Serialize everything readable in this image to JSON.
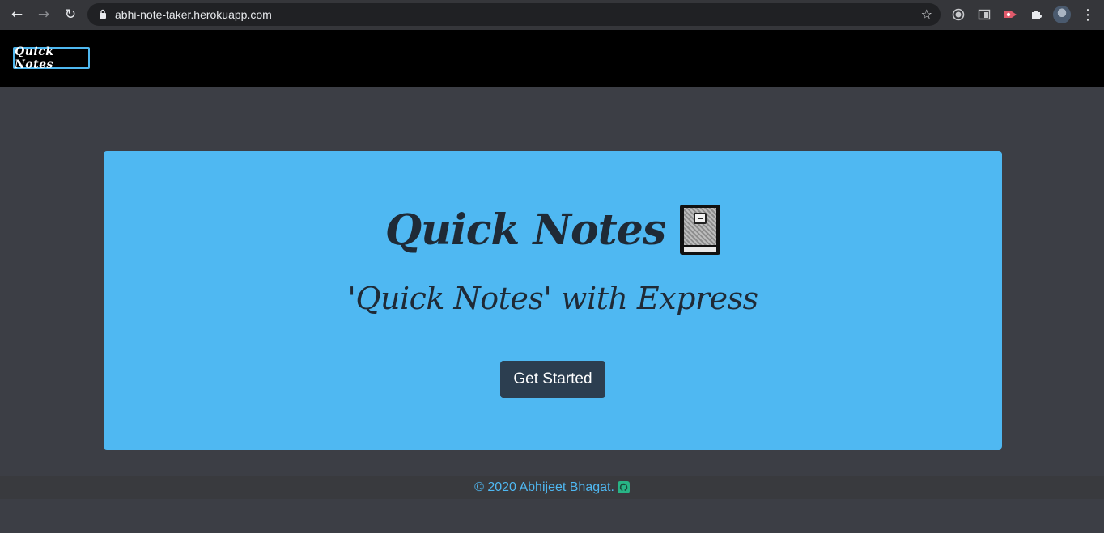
{
  "browser": {
    "url": "abhi-note-taker.herokuapp.com"
  },
  "navbar": {
    "brand": "Quick Notes"
  },
  "hero": {
    "title": "Quick Notes",
    "subtitle": "'Quick Notes' with Express",
    "cta_label": "Get Started"
  },
  "footer": {
    "copyright": "© 2020 Abhijeet Bhagat."
  },
  "colors": {
    "page_bg": "#3c3e45",
    "navbar_bg": "#000000",
    "hero_bg": "#4fb8f2",
    "button_bg": "#2c3e50",
    "footer_text": "#4fb8f2",
    "github_icon": "#28b485"
  },
  "icons": {
    "hero_icon": "notebook-icon",
    "footer_icon": "github-icon"
  }
}
